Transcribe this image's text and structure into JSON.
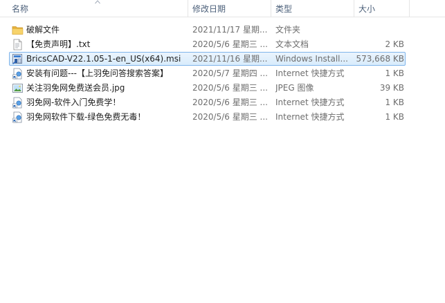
{
  "columns": {
    "name": "名称",
    "date": "修改日期",
    "type": "类型",
    "size": "大小"
  },
  "files": [
    {
      "name": "破解文件",
      "date": "2021/11/17 星期...",
      "type": "文件夹",
      "size": "",
      "icon": "folder-icon"
    },
    {
      "name": "【免责声明】.txt",
      "date": "2020/5/6 星期三 ...",
      "type": "文本文档",
      "size": "2 KB",
      "icon": "text-file-icon"
    },
    {
      "name": "BricsCAD-V22.1.05-1-en_US(x64).msi",
      "date": "2021/11/16 星期...",
      "type": "Windows Install...",
      "size": "573,668 KB",
      "icon": "msi-installer-icon"
    },
    {
      "name": "安装有问题---【上羽免问答搜索答案】",
      "date": "2020/5/7 星期四 ...",
      "type": "Internet 快捷方式",
      "size": "1 KB",
      "icon": "internet-shortcut-icon"
    },
    {
      "name": "关注羽免网免费送会员.jpg",
      "date": "2020/5/6 星期三 ...",
      "type": "JPEG 图像",
      "size": "39 KB",
      "icon": "image-file-icon"
    },
    {
      "name": "羽免网-软件入门免费学！",
      "date": "2020/5/6 星期三 ...",
      "type": "Internet 快捷方式",
      "size": "1 KB",
      "icon": "internet-shortcut-icon"
    },
    {
      "name": "羽免网软件下载-绿色免费无毒！",
      "date": "2020/5/6 星期三 ...",
      "type": "Internet 快捷方式",
      "size": "1 KB",
      "icon": "internet-shortcut-icon"
    }
  ],
  "selected_index": 2
}
